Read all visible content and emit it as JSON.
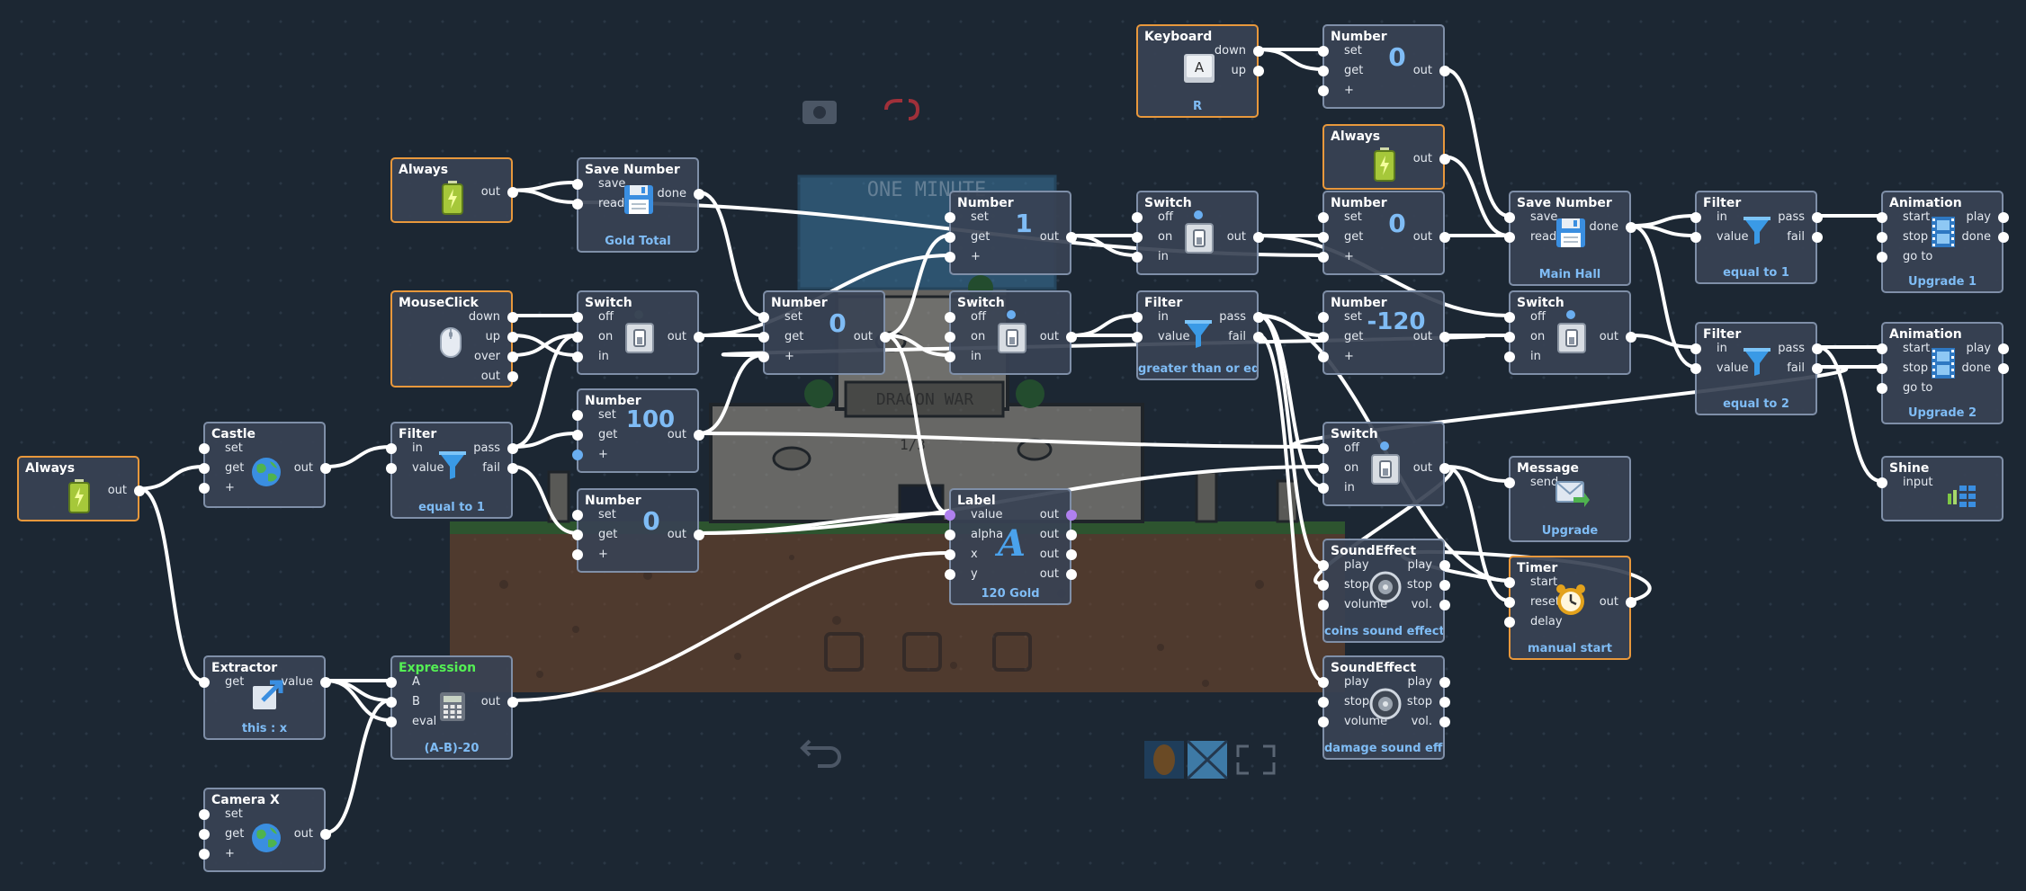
{
  "colors": {
    "background": "#1c2733",
    "node_border": "#7f8fa8",
    "node_highlight": "#e8983c",
    "node_fill": "#384254",
    "value_blue": "#7fbcf5",
    "wire": "#ffffff"
  },
  "game_preview": {
    "title_sign": "ONE MINUTE",
    "castle_sign": "DRAGON WAR",
    "level": "1/3"
  },
  "toolbar": {
    "undo_icon": "undo-icon",
    "terrain_icon": "terrain-icon",
    "tile_icon": "tile-icon",
    "fullscreen_icon": "fullscreen-icon",
    "camera_icon": "camera-icon",
    "link_icon": "link-icon"
  },
  "nodes": {
    "always_main": {
      "title": "Always",
      "outs": [
        "out"
      ]
    },
    "castle": {
      "title": "Castle",
      "ins": [
        "set",
        "get",
        "+"
      ],
      "outs": [
        "out"
      ]
    },
    "extractor": {
      "title": "Extractor",
      "ins": [
        "get"
      ],
      "outs": [
        "value"
      ],
      "caption": "this : x"
    },
    "camera_x": {
      "title": "Camera X",
      "ins": [
        "set",
        "get",
        "+"
      ],
      "outs": [
        "out"
      ]
    },
    "always_save": {
      "title": "Always",
      "outs": [
        "out"
      ]
    },
    "mouseclick": {
      "title": "MouseClick",
      "outs": [
        "down",
        "up",
        "over",
        "out"
      ]
    },
    "filter_castle": {
      "title": "Filter",
      "ins": [
        "in",
        "value"
      ],
      "outs": [
        "pass",
        "fail"
      ],
      "caption": "equal to 1"
    },
    "expression": {
      "title": "Expression",
      "ins": [
        "A",
        "B",
        "eval"
      ],
      "outs": [
        "out"
      ],
      "caption": "(A-B)-20"
    },
    "save_gold": {
      "title": "Save Number",
      "ins": [
        "save",
        "read"
      ],
      "outs": [
        "done"
      ],
      "caption": "Gold Total"
    },
    "switch_a": {
      "title": "Switch",
      "ins": [
        "off",
        "on",
        "in"
      ],
      "outs": [
        "out"
      ]
    },
    "number_100": {
      "title": "Number",
      "ins": [
        "set",
        "get",
        "+"
      ],
      "outs": [
        "out"
      ],
      "value": "100"
    },
    "number_0b": {
      "title": "Number",
      "ins": [
        "set",
        "get",
        "+"
      ],
      "outs": [
        "out"
      ],
      "value": "0"
    },
    "number_0a": {
      "title": "Number",
      "ins": [
        "set",
        "get",
        "+"
      ],
      "outs": [
        "out"
      ],
      "value": "0"
    },
    "number_1": {
      "title": "Number",
      "ins": [
        "set",
        "get",
        "+"
      ],
      "outs": [
        "out"
      ],
      "value": "1"
    },
    "switch_b": {
      "title": "Switch",
      "ins": [
        "off",
        "on",
        "in"
      ],
      "outs": [
        "out"
      ]
    },
    "label": {
      "title": "Label",
      "ins": [
        "value",
        "alpha",
        "x",
        "y"
      ],
      "outs": [
        "out",
        "out",
        "out",
        "out"
      ],
      "caption": "120 Gold"
    },
    "switch_c": {
      "title": "Switch",
      "ins": [
        "off",
        "on",
        "in"
      ],
      "outs": [
        "out"
      ]
    },
    "filter_gte": {
      "title": "Filter",
      "ins": [
        "in",
        "value"
      ],
      "outs": [
        "pass",
        "fail"
      ],
      "caption": "greater than or equ"
    },
    "keyboard": {
      "title": "Keyboard",
      "outs": [
        "down",
        "up"
      ],
      "key": "A",
      "caption": "R"
    },
    "number_kb": {
      "title": "Number",
      "ins": [
        "set",
        "get",
        "+"
      ],
      "outs": [
        "out"
      ],
      "value": "0"
    },
    "always_hall": {
      "title": "Always",
      "outs": [
        "out"
      ]
    },
    "number_hall": {
      "title": "Number",
      "ins": [
        "set",
        "get",
        "+"
      ],
      "outs": [
        "out"
      ],
      "value": "0"
    },
    "number_cost": {
      "title": "Number",
      "ins": [
        "set",
        "get",
        "+"
      ],
      "outs": [
        "out"
      ],
      "value": "-120"
    },
    "switch_d": {
      "title": "Switch",
      "ins": [
        "off",
        "on",
        "in"
      ],
      "outs": [
        "out"
      ]
    },
    "soundeffect_coins": {
      "title": "SoundEffect",
      "ins": [
        "play",
        "stop",
        "volume"
      ],
      "outs": [
        "play",
        "stop",
        "vol."
      ],
      "caption": "coins sound effect"
    },
    "soundeffect_damage": {
      "title": "SoundEffect",
      "ins": [
        "play",
        "stop",
        "volume"
      ],
      "outs": [
        "play",
        "stop",
        "vol."
      ],
      "caption": "damage sound effec"
    },
    "save_hall": {
      "title": "Save Number",
      "ins": [
        "save",
        "read"
      ],
      "outs": [
        "done"
      ],
      "caption": "Main Hall"
    },
    "switch_e": {
      "title": "Switch",
      "ins": [
        "off",
        "on",
        "in"
      ],
      "outs": [
        "out"
      ]
    },
    "message": {
      "title": "Message",
      "ins": [
        "send"
      ],
      "caption": "Upgrade"
    },
    "timer": {
      "title": "Timer",
      "ins": [
        "start",
        "reset",
        "delay"
      ],
      "outs": [
        "out"
      ],
      "caption": "manual start"
    },
    "filter_eq1": {
      "title": "Filter",
      "ins": [
        "in",
        "value"
      ],
      "outs": [
        "pass",
        "fail"
      ],
      "caption": "equal to 1"
    },
    "filter_eq2": {
      "title": "Filter",
      "ins": [
        "in",
        "value"
      ],
      "outs": [
        "pass",
        "fail"
      ],
      "caption": "equal to 2"
    },
    "animation_1": {
      "title": "Animation",
      "ins": [
        "start",
        "stop",
        "go to"
      ],
      "outs": [
        "play",
        "done"
      ],
      "caption": "Upgrade 1"
    },
    "animation_2": {
      "title": "Animation",
      "ins": [
        "start",
        "stop",
        "go to"
      ],
      "outs": [
        "play",
        "done"
      ],
      "caption": "Upgrade 2"
    },
    "shine": {
      "title": "Shine",
      "ins": [
        "input"
      ]
    }
  }
}
